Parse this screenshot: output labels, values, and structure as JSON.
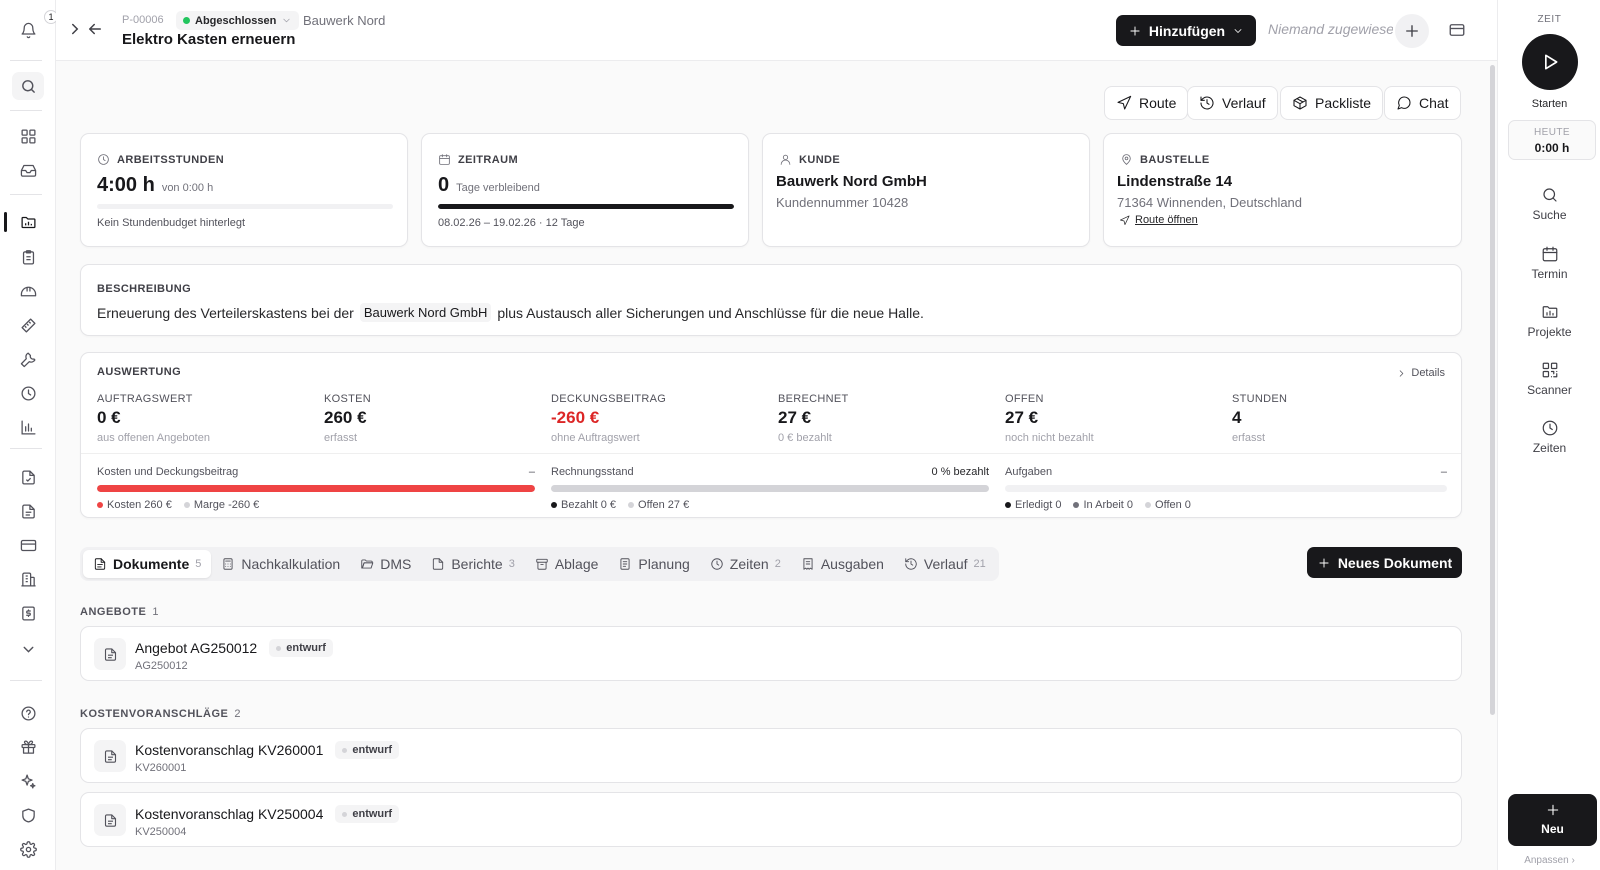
{
  "header": {
    "notification_count": "1",
    "project_id": "P-00006",
    "status": "Abgeschlossen",
    "customer": "Bauwerk Nord",
    "title": "Elektro Kasten erneuern",
    "add_label": "Hinzufügen",
    "assignee_placeholder": "Niemand zugewiesen"
  },
  "actions": {
    "route": "Route",
    "history": "Verlauf",
    "packlist": "Packliste",
    "chat": "Chat"
  },
  "cards": {
    "hours": {
      "label": "ARBEITSSTUNDEN",
      "value": "4:00 h",
      "sub": "von 0:00 h",
      "note": "Kein Stundenbudget hinterlegt",
      "progress": 0
    },
    "period": {
      "label": "ZEITRAUM",
      "value": "0",
      "sub": "Tage verbleibend",
      "note": "08.02.26 – 19.02.26 · 12 Tage",
      "progress": 1.0
    },
    "customer": {
      "label": "KUNDE",
      "name": "Bauwerk Nord GmbH",
      "number": "Kundennummer 10428"
    },
    "site": {
      "label": "BAUSTELLE",
      "street": "Lindenstraße 14",
      "city": "71364 Winnenden, Deutschland",
      "route_link": "Route öffnen"
    }
  },
  "description": {
    "label": "BESCHREIBUNG",
    "before": "Erneuerung des Verteilerskastens bei der",
    "mention": "Bauwerk Nord GmbH",
    "after": "plus Austausch aller Sicherungen und Anschlüsse für die neue Halle."
  },
  "evaluation": {
    "label": "AUSWERTUNG",
    "details": "Details",
    "kpis": [
      {
        "label": "AUFTRAGSWERT",
        "value": "0 €",
        "sub": "aus offenen Angeboten"
      },
      {
        "label": "KOSTEN",
        "value": "260 €",
        "sub": "erfasst"
      },
      {
        "label": "DECKUNGSBEITRAG",
        "value": "-260 €",
        "sub": "ohne Auftragswert"
      },
      {
        "label": "BERECHNET",
        "value": "27 €",
        "sub": "0 € bezahlt"
      },
      {
        "label": "OFFEN",
        "value": "27 €",
        "sub": "noch nicht bezahlt"
      },
      {
        "label": "STUNDEN",
        "value": "4",
        "sub": "erfasst"
      }
    ],
    "bars": {
      "cost": {
        "title": "Kosten und Deckungsbeitrag",
        "right": "–",
        "legend_a": "Kosten 260 €",
        "legend_b": "Marge -260 €",
        "fill": 1.0,
        "color": "#ef4444"
      },
      "invoice": {
        "title": "Rechnungsstand",
        "right": "0 % bezahlt",
        "legend_a": "Bezahlt 0 €",
        "legend_b": "Offen 27 €",
        "fill": 1.0,
        "color": "#d4d4d8"
      },
      "tasks": {
        "title": "Aufgaben",
        "right": "–",
        "legend_a": "Erledigt 0",
        "legend_b": "In Arbeit 0",
        "legend_c": "Offen 0",
        "fill": 0,
        "color": "#18181b"
      }
    }
  },
  "tabs": [
    {
      "label": "Dokumente",
      "count": "5"
    },
    {
      "label": "Nachkalkulation",
      "count": ""
    },
    {
      "label": "DMS",
      "count": ""
    },
    {
      "label": "Berichte",
      "count": "3"
    },
    {
      "label": "Ablage",
      "count": ""
    },
    {
      "label": "Planung",
      "count": ""
    },
    {
      "label": "Zeiten",
      "count": "2"
    },
    {
      "label": "Ausgaben",
      "count": ""
    },
    {
      "label": "Verlauf",
      "count": "21"
    }
  ],
  "new_document": "Neues Dokument",
  "sections": {
    "offers": {
      "title": "ANGEBOTE",
      "count": "1"
    },
    "estimates": {
      "title": "KOSTENVORANSCHLÄGE",
      "count": "2"
    }
  },
  "documents": [
    {
      "title": "Angebot AG250012",
      "number": "AG250012",
      "status": "entwurf"
    },
    {
      "title": "Kostenvoranschlag KV260001",
      "number": "KV260001",
      "status": "entwurf"
    },
    {
      "title": "Kostenvoranschlag KV250004",
      "number": "KV250004",
      "status": "entwurf"
    }
  ],
  "right_rail": {
    "time_label": "ZEIT",
    "start": "Starten",
    "today_label": "HEUTE",
    "today_value": "0:00 h",
    "items": [
      "Suche",
      "Termin",
      "Projekte",
      "Scanner",
      "Zeiten"
    ],
    "new": "Neu",
    "customize": "Anpassen"
  },
  "colors": {
    "accent": "#18181b",
    "status_green": "#22c55e",
    "negative": "#dc2626"
  }
}
